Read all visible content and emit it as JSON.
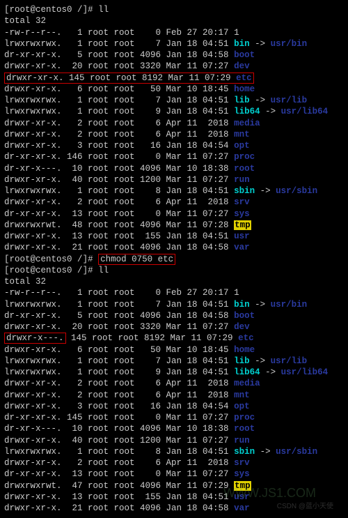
{
  "prompt": {
    "lbrace": "[",
    "user_host": "root@centos0",
    "path": "/",
    "rbrace": "]#"
  },
  "commands": {
    "ll": "ll",
    "chmod": "chmod 0750 etc"
  },
  "total": "total 32",
  "sec1": [
    {
      "perm": "-rw-r--r--.",
      "n": "  1",
      "sz": "   0",
      "dt": "Feb 27 20:17",
      "name": "1",
      "cls": "white"
    },
    {
      "perm": "lrwxrwxrwx.",
      "n": "  1",
      "sz": "   7",
      "dt": "Jan 18 04:51",
      "name": "bin",
      "cls": "cyan",
      "arrow": " -> ",
      "tgt": "usr/bin",
      "tcls": "dblue"
    },
    {
      "perm": "dr-xr-xr-x.",
      "n": "  5",
      "sz": "4096",
      "dt": "Jan 18 04:58",
      "name": "boot",
      "cls": "dblue"
    },
    {
      "perm": "drwxr-xr-x.",
      "n": " 20",
      "sz": "3320",
      "dt": "Mar 11 07:27",
      "name": "dev",
      "cls": "dblue"
    },
    {
      "perm": "drwxr-xr-x.",
      "n": "145",
      "sz": "8192",
      "dt": "Mar 11 07:29",
      "name": "etc",
      "cls": "dblue",
      "box": true
    },
    {
      "perm": "drwxr-xr-x.",
      "n": "  6",
      "sz": "  50",
      "dt": "Mar 10 18:45",
      "name": "home",
      "cls": "dblue"
    },
    {
      "perm": "lrwxrwxrwx.",
      "n": "  1",
      "sz": "   7",
      "dt": "Jan 18 04:51",
      "name": "lib",
      "cls": "cyan",
      "arrow": " -> ",
      "tgt": "usr/lib",
      "tcls": "dblue"
    },
    {
      "perm": "lrwxrwxrwx.",
      "n": "  1",
      "sz": "   9",
      "dt": "Jan 18 04:51",
      "name": "lib64",
      "cls": "cyan",
      "arrow": " -> ",
      "tgt": "usr/lib64",
      "tcls": "dblue"
    },
    {
      "perm": "drwxr-xr-x.",
      "n": "  2",
      "sz": "   6",
      "dt": "Apr 11  2018",
      "name": "media",
      "cls": "dblue"
    },
    {
      "perm": "drwxr-xr-x.",
      "n": "  2",
      "sz": "   6",
      "dt": "Apr 11  2018",
      "name": "mnt",
      "cls": "dblue"
    },
    {
      "perm": "drwxr-xr-x.",
      "n": "  3",
      "sz": "  16",
      "dt": "Jan 18 04:54",
      "name": "opt",
      "cls": "dblue"
    },
    {
      "perm": "dr-xr-xr-x.",
      "n": "146",
      "sz": "   0",
      "dt": "Mar 11 07:27",
      "name": "proc",
      "cls": "dblue"
    },
    {
      "perm": "dr-xr-x---.",
      "n": " 10",
      "sz": "4096",
      "dt": "Mar 10 18:38",
      "name": "root",
      "cls": "dblue"
    },
    {
      "perm": "drwxr-xr-x.",
      "n": " 40",
      "sz": "1200",
      "dt": "Mar 11 07:27",
      "name": "run",
      "cls": "dblue"
    },
    {
      "perm": "lrwxrwxrwx.",
      "n": "  1",
      "sz": "   8",
      "dt": "Jan 18 04:51",
      "name": "sbin",
      "cls": "cyan",
      "arrow": " -> ",
      "tgt": "usr/sbin",
      "tcls": "dblue"
    },
    {
      "perm": "drwxr-xr-x.",
      "n": "  2",
      "sz": "   6",
      "dt": "Apr 11  2018",
      "name": "srv",
      "cls": "dblue"
    },
    {
      "perm": "dr-xr-xr-x.",
      "n": " 13",
      "sz": "   0",
      "dt": "Mar 11 07:27",
      "name": "sys",
      "cls": "dblue"
    },
    {
      "perm": "drwxrwxrwt.",
      "n": " 48",
      "sz": "4096",
      "dt": "Mar 11 07:28",
      "name": "tmp",
      "cls": "yellowhl"
    },
    {
      "perm": "drwxr-xr-x.",
      "n": " 13",
      "sz": " 155",
      "dt": "Jan 18 04:51",
      "name": "usr",
      "cls": "dblue"
    },
    {
      "perm": "drwxr-xr-x.",
      "n": " 21",
      "sz": "4096",
      "dt": "Jan 18 04:58",
      "name": "var",
      "cls": "dblue"
    }
  ],
  "sec2": [
    {
      "perm": "-rw-r--r--.",
      "n": "  1",
      "sz": "   0",
      "dt": "Feb 27 20:17",
      "name": "1",
      "cls": "white"
    },
    {
      "perm": "lrwxrwxrwx.",
      "n": "  1",
      "sz": "   7",
      "dt": "Jan 18 04:51",
      "name": "bin",
      "cls": "cyan",
      "arrow": " -> ",
      "tgt": "usr/bin",
      "tcls": "dblue"
    },
    {
      "perm": "dr-xr-xr-x.",
      "n": "  5",
      "sz": "4096",
      "dt": "Jan 18 04:58",
      "name": "boot",
      "cls": "dblue"
    },
    {
      "perm": "drwxr-xr-x.",
      "n": " 20",
      "sz": "3320",
      "dt": "Mar 11 07:27",
      "name": "dev",
      "cls": "dblue"
    },
    {
      "perm": "drwxr-x---.",
      "n": "145",
      "sz": "8192",
      "dt": "Mar 11 07:29",
      "name": "etc",
      "cls": "dblue",
      "pbox": true
    },
    {
      "perm": "drwxr-xr-x.",
      "n": "  6",
      "sz": "  50",
      "dt": "Mar 10 18:45",
      "name": "home",
      "cls": "dblue"
    },
    {
      "perm": "lrwxrwxrwx.",
      "n": "  1",
      "sz": "   7",
      "dt": "Jan 18 04:51",
      "name": "lib",
      "cls": "cyan",
      "arrow": " -> ",
      "tgt": "usr/lib",
      "tcls": "dblue"
    },
    {
      "perm": "lrwxrwxrwx.",
      "n": "  1",
      "sz": "   9",
      "dt": "Jan 18 04:51",
      "name": "lib64",
      "cls": "cyan",
      "arrow": " -> ",
      "tgt": "usr/lib64",
      "tcls": "dblue"
    },
    {
      "perm": "drwxr-xr-x.",
      "n": "  2",
      "sz": "   6",
      "dt": "Apr 11  2018",
      "name": "media",
      "cls": "dblue"
    },
    {
      "perm": "drwxr-xr-x.",
      "n": "  2",
      "sz": "   6",
      "dt": "Apr 11  2018",
      "name": "mnt",
      "cls": "dblue"
    },
    {
      "perm": "drwxr-xr-x.",
      "n": "  3",
      "sz": "  16",
      "dt": "Jan 18 04:54",
      "name": "opt",
      "cls": "dblue"
    },
    {
      "perm": "dr-xr-xr-x.",
      "n": "145",
      "sz": "   0",
      "dt": "Mar 11 07:27",
      "name": "proc",
      "cls": "dblue"
    },
    {
      "perm": "dr-xr-x---.",
      "n": " 10",
      "sz": "4096",
      "dt": "Mar 10 18:38",
      "name": "root",
      "cls": "dblue"
    },
    {
      "perm": "drwxr-xr-x.",
      "n": " 40",
      "sz": "1200",
      "dt": "Mar 11 07:27",
      "name": "run",
      "cls": "dblue"
    },
    {
      "perm": "lrwxrwxrwx.",
      "n": "  1",
      "sz": "   8",
      "dt": "Jan 18 04:51",
      "name": "sbin",
      "cls": "cyan",
      "arrow": " -> ",
      "tgt": "usr/sbin",
      "tcls": "dblue"
    },
    {
      "perm": "drwxr-xr-x.",
      "n": "  2",
      "sz": "   6",
      "dt": "Apr 11  2018",
      "name": "srv",
      "cls": "dblue"
    },
    {
      "perm": "dr-xr-xr-x.",
      "n": " 13",
      "sz": "   0",
      "dt": "Mar 11 07:27",
      "name": "sys",
      "cls": "dblue"
    },
    {
      "perm": "drwxrwxrwt.",
      "n": " 47",
      "sz": "4096",
      "dt": "Mar 11 07:29",
      "name": "tmp",
      "cls": "yellowhl"
    },
    {
      "perm": "drwxr-xr-x.",
      "n": " 13",
      "sz": " 155",
      "dt": "Jan 18 04:51",
      "name": "usr",
      "cls": "dblue"
    },
    {
      "perm": "drwxr-xr-x.",
      "n": " 21",
      "sz": "4096",
      "dt": "Jan 18 04:58",
      "name": "var",
      "cls": "dblue"
    }
  ],
  "watermark": "WWW.JS1.COM",
  "csdn": "CSDN @蓝小天使"
}
